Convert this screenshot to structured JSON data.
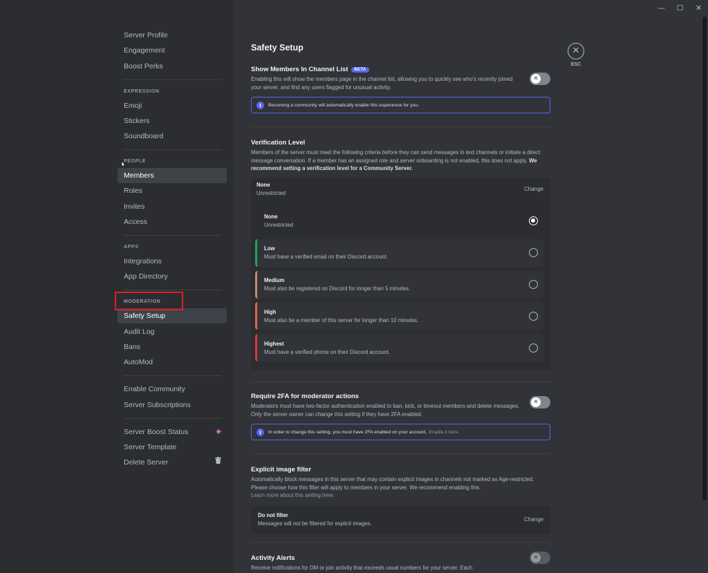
{
  "window": {
    "minimize": "—",
    "maximize": "☐",
    "close": "✕"
  },
  "sidebar": {
    "items_top": [
      "Server Profile",
      "Engagement",
      "Boost Perks"
    ],
    "expression": {
      "header": "EXPRESSION",
      "items": [
        "Emoji",
        "Stickers",
        "Soundboard"
      ]
    },
    "people": {
      "header": "PEOPLE",
      "items": [
        "Members",
        "Roles",
        "Invites",
        "Access"
      ]
    },
    "apps": {
      "header": "APPS",
      "items": [
        "Integrations",
        "App Directory"
      ]
    },
    "moderation": {
      "header": "MODERATION",
      "items": [
        "Safety Setup",
        "Audit Log",
        "Bans",
        "AutoMod"
      ]
    },
    "community": [
      "Enable Community",
      "Server Subscriptions"
    ],
    "bottom": [
      "Server Boost Status",
      "Server Template",
      "Delete Server"
    ],
    "active": "Safety Setup"
  },
  "main": {
    "title": "Safety Setup",
    "show_members": {
      "title": "Show Members In Channel List",
      "badge": "BETA",
      "desc": "Enabling this will show the members page in the channel list, allowing you to quickly see who's recently joined your server, and find any users flagged for unusual activity.",
      "info": "Becoming a community will automatically enable this experience for you.",
      "enabled": false
    },
    "verification": {
      "title": "Verification Level",
      "desc": "Members of the server must meet the following criteria before they can send messages in text channels or initiate a direct message conversation. If a member has an assigned role and server onboarding is not enabled, this does not apply.",
      "desc_bold": "We recommend setting a verification level for a Community Server.",
      "current_name": "None",
      "current_desc": "Unrestricted",
      "change": "Change",
      "options": [
        {
          "name": "None",
          "desc": "Unrestricted",
          "color": "#2b2d31",
          "selected": true
        },
        {
          "name": "Low",
          "desc": "Must have a verified email on their Discord account.",
          "color": "#23a55a",
          "selected": false
        },
        {
          "name": "Medium",
          "desc": "Must also be registered on Discord for longer than 5 minutes.",
          "color": "#c78a6f",
          "selected": false
        },
        {
          "name": "High",
          "desc": "Must also be a member of this server for longer than 10 minutes.",
          "color": "#e0644b",
          "selected": false
        },
        {
          "name": "Highest",
          "desc": "Must have a verified phone on their Discord account.",
          "color": "#da373c",
          "selected": false
        }
      ]
    },
    "twofa": {
      "title": "Require 2FA for moderator actions",
      "desc": "Moderators must have two-factor authentication enabled to ban, kick, or timeout members and delete messages. Only the server owner can change this setting if they have 2FA enabled.",
      "info": "In order to change this setting, you must have 2FA enabled on your account.",
      "info_link": "Enable it here.",
      "enabled": false
    },
    "explicit": {
      "title": "Explicit image filter",
      "desc": "Automatically block messages in this server that may contain explicit images in channels not marked as Age-restricted. Please choose how this filter will apply to members in your server. We recommend enabling this.",
      "link": "Learn more about this setting here.",
      "current_name": "Do not filter",
      "current_desc": "Messages will not be filtered for explicit images.",
      "change": "Change"
    },
    "activity": {
      "title": "Activity Alerts",
      "desc": "Receive notifications for DM or join activity that exceeds usual numbers for your server. Each",
      "enabled": false
    }
  },
  "close": {
    "icon": "✕",
    "label": "ESC"
  },
  "icons": {
    "toggle_off": "✕",
    "info": "i",
    "boost": "◈",
    "trash": "🗑"
  }
}
